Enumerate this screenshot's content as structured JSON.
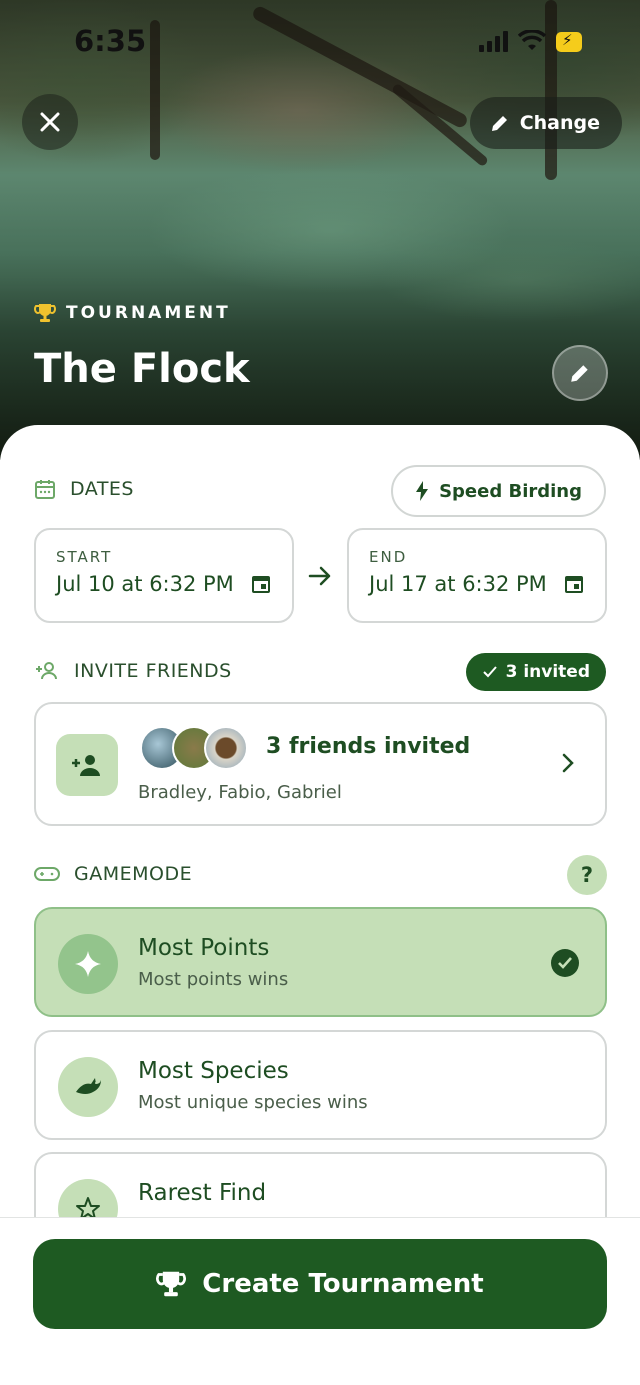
{
  "status_bar": {
    "time": "6:35"
  },
  "hero": {
    "change_label": "Change",
    "kind_label": "TOURNAMENT",
    "title": "The Flock"
  },
  "dates": {
    "section_label": "DATES",
    "speed_label": "Speed Birding",
    "start": {
      "label": "START",
      "value": "Jul 10 at 6:32 PM"
    },
    "end": {
      "label": "END",
      "value": "Jul 17 at 6:32 PM"
    }
  },
  "invite": {
    "section_label": "INVITE FRIENDS",
    "badge": "3 invited",
    "card_title": "3 friends invited",
    "names": "Bradley, Fabio, Gabriel"
  },
  "gamemode": {
    "section_label": "GAMEMODE",
    "help": "?",
    "modes": [
      {
        "title": "Most Points",
        "desc": "Most points wins",
        "selected": true,
        "icon": "sparkle-icon"
      },
      {
        "title": "Most Species",
        "desc": "Most unique species wins",
        "selected": false,
        "icon": "bird-icon"
      },
      {
        "title": "Rarest Find",
        "desc": "",
        "selected": false,
        "icon": "star-icon"
      }
    ]
  },
  "create_button": "Create Tournament",
  "colors": {
    "primary": "#1e5a22",
    "accent_light": "#c5dfb7",
    "text_dark": "#1e4d22"
  }
}
